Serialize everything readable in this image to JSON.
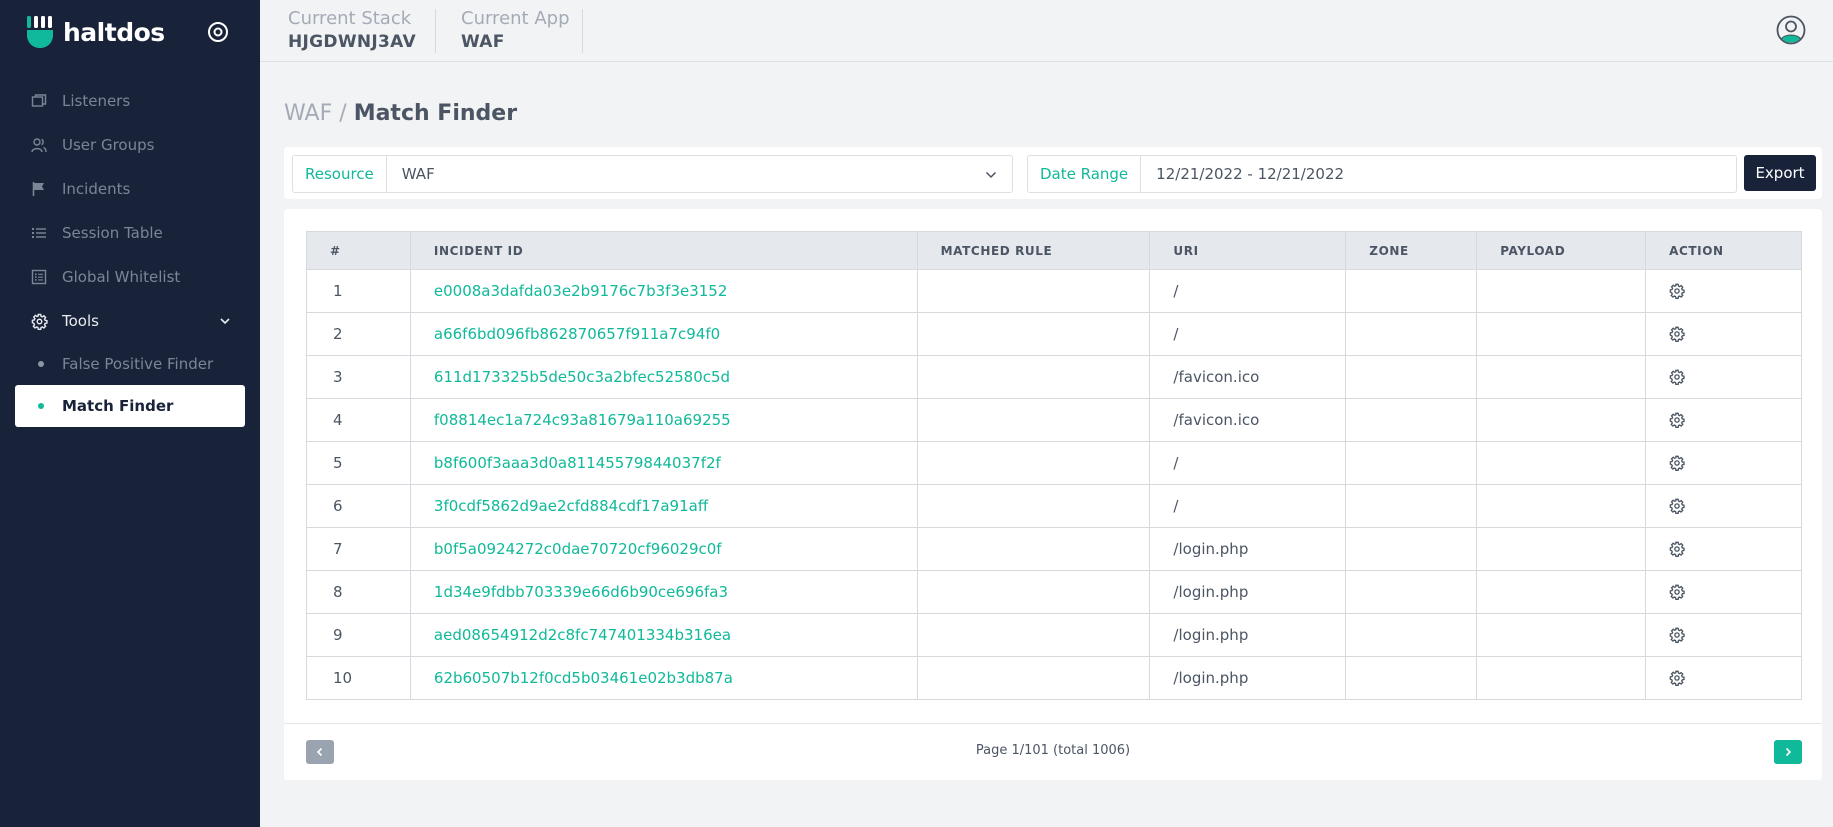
{
  "brand": {
    "name": "haltdos",
    "logo_icon": "haltdos-logo-icon",
    "accent": "#10b999",
    "sidebar_bg": "#18233a"
  },
  "topbar": {
    "stack_label": "Current Stack",
    "stack_value": "HJGDWNJ3AV",
    "app_label": "Current App",
    "app_value": "WAF"
  },
  "sidebar": {
    "items": [
      {
        "label": "Listeners",
        "icon": "window-icon"
      },
      {
        "label": "User Groups",
        "icon": "users-icon"
      },
      {
        "label": "Incidents",
        "icon": "flag-icon"
      },
      {
        "label": "Session Table",
        "icon": "list-icon"
      },
      {
        "label": "Global Whitelist",
        "icon": "document-list-icon"
      }
    ],
    "tools": {
      "label": "Tools",
      "icon": "gear-icon",
      "expanded": true,
      "children": [
        {
          "label": "False Positive Finder",
          "active": false
        },
        {
          "label": "Match Finder",
          "active": true
        }
      ]
    }
  },
  "breadcrumb": {
    "parent": "WAF",
    "separator": "/",
    "current": "Match Finder"
  },
  "filters": {
    "resource_label": "Resource",
    "resource_value": "WAF",
    "date_label": "Date Range",
    "date_value": "12/21/2022 - 12/21/2022",
    "export_label": "Export"
  },
  "table": {
    "headers": [
      "#",
      "INCIDENT ID",
      "MATCHED RULE",
      "URI",
      "ZONE",
      "PAYLOAD",
      "ACTION"
    ],
    "rows": [
      {
        "idx": "1",
        "incident_id": "e0008a3dafda03e2b9176c7b3f3e3152",
        "matched_rule": "",
        "uri": "/",
        "zone": "",
        "payload": ""
      },
      {
        "idx": "2",
        "incident_id": "a66f6bd096fb862870657f911a7c94f0",
        "matched_rule": "",
        "uri": "/",
        "zone": "",
        "payload": ""
      },
      {
        "idx": "3",
        "incident_id": "611d173325b5de50c3a2bfec52580c5d",
        "matched_rule": "",
        "uri": "/favicon.ico",
        "zone": "",
        "payload": ""
      },
      {
        "idx": "4",
        "incident_id": "f08814ec1a724c93a81679a110a69255",
        "matched_rule": "",
        "uri": "/favicon.ico",
        "zone": "",
        "payload": ""
      },
      {
        "idx": "5",
        "incident_id": "b8f600f3aaa3d0a81145579844037f2f",
        "matched_rule": "",
        "uri": "/",
        "zone": "",
        "payload": ""
      },
      {
        "idx": "6",
        "incident_id": "3f0cdf5862d9ae2cfd884cdf17a91aff",
        "matched_rule": "",
        "uri": "/",
        "zone": "",
        "payload": ""
      },
      {
        "idx": "7",
        "incident_id": "b0f5a0924272c0dae70720cf96029c0f",
        "matched_rule": "",
        "uri": "/login.php",
        "zone": "",
        "payload": ""
      },
      {
        "idx": "8",
        "incident_id": "1d34e9fdbb703339e66d6b90ce696fa3",
        "matched_rule": "",
        "uri": "/login.php",
        "zone": "",
        "payload": ""
      },
      {
        "idx": "9",
        "incident_id": "aed08654912d2c8fc747401334b316ea",
        "matched_rule": "",
        "uri": "/login.php",
        "zone": "",
        "payload": ""
      },
      {
        "idx": "10",
        "incident_id": "62b60507b12f0cd5b03461e02b3db87a",
        "matched_rule": "",
        "uri": "/login.php",
        "zone": "",
        "payload": ""
      }
    ],
    "action_icon": "gear-icon"
  },
  "pagination": {
    "text": "Page 1/101 (total 1006)",
    "prev_icon": "chevron-left-icon",
    "next_icon": "chevron-right-icon"
  }
}
